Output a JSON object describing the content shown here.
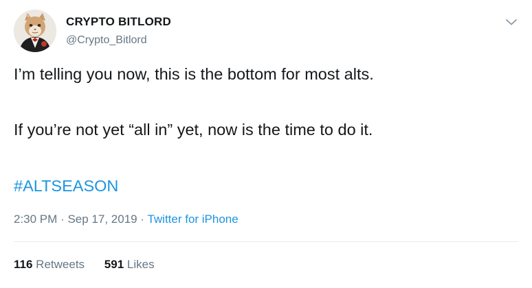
{
  "author": {
    "name": "CRYPTO BITLORD",
    "handle": "@Crypto_Bitlord",
    "avatar_icon": "cat-in-tuxedo-avatar"
  },
  "menu": {
    "icon": "chevron-down-icon"
  },
  "tweet": {
    "lines": [
      "I’m telling you now, this is the bottom for most alts.",
      "If you’re not yet “all in” yet, now is the time to do it."
    ],
    "hashtag": "#ALTSEASON"
  },
  "meta": {
    "time": "2:30 PM",
    "separator": "·",
    "date": "Sep 17, 2019",
    "source": "Twitter for iPhone"
  },
  "stats": {
    "retweets_count": "116",
    "retweets_label": "Retweets",
    "likes_count": "591",
    "likes_label": "Likes"
  },
  "colors": {
    "text": "#14171a",
    "muted": "#657786",
    "link": "#1b95e0",
    "divider": "#e6ecf0"
  }
}
